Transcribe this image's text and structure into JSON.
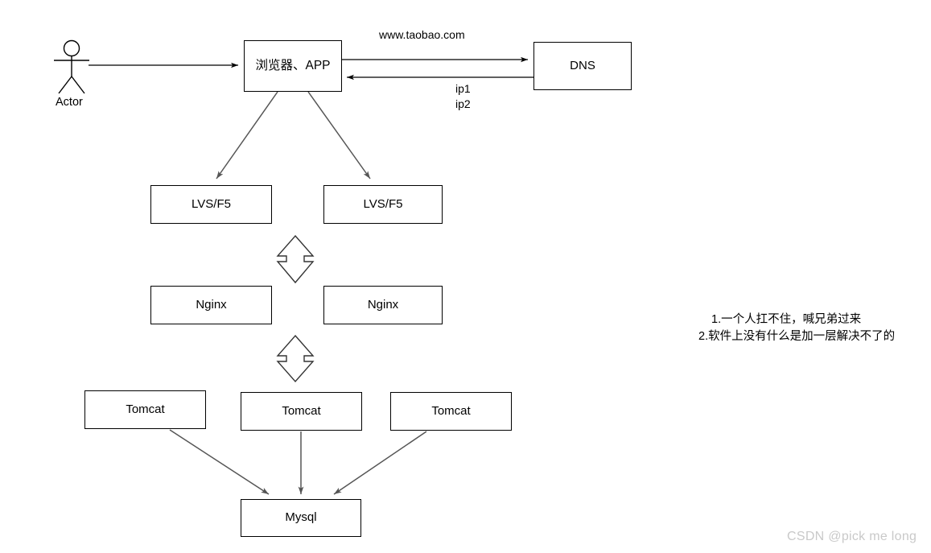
{
  "diagram": {
    "actor": {
      "label": "Actor"
    },
    "nodes": [
      {
        "id": "browser",
        "label": "浏览器、APP"
      },
      {
        "id": "dns",
        "label": "DNS"
      },
      {
        "id": "lvs_left",
        "label": "LVS/F5"
      },
      {
        "id": "lvs_right",
        "label": "LVS/F5"
      },
      {
        "id": "nginx_left",
        "label": "Nginx"
      },
      {
        "id": "nginx_right",
        "label": "Nginx"
      },
      {
        "id": "tomcat_left",
        "label": "Tomcat"
      },
      {
        "id": "tomcat_mid",
        "label": "Tomcat"
      },
      {
        "id": "tomcat_right",
        "label": "Tomcat"
      },
      {
        "id": "mysql",
        "label": "Mysql"
      }
    ],
    "edge_labels": {
      "request_domain": "www.taobao.com",
      "response_ip1": "ip1",
      "response_ip2": "ip2"
    },
    "notes": [
      "1.一个人扛不住，喊兄弟过来",
      "2.软件上没有什么是加一层解决不了的"
    ],
    "watermark": "CSDN @pick me long",
    "colors": {
      "stroke": "#000000",
      "connector": "#555555",
      "background": "#ffffff",
      "watermark": "#c9c9c9"
    }
  }
}
